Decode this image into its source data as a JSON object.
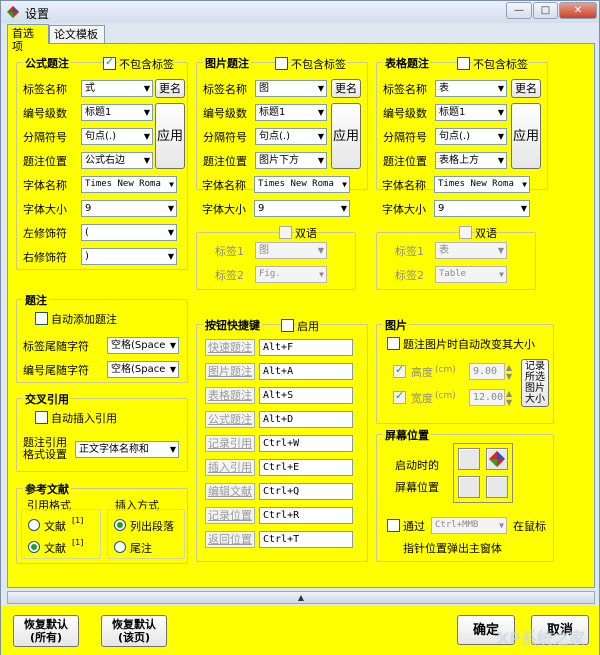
{
  "window": {
    "title": "设置",
    "controls": [
      "—",
      "□",
      "✕"
    ]
  },
  "tabs": [
    "首选项",
    "论文模板"
  ],
  "formula": {
    "title": "公式题注",
    "exclude_label": "不包含标签",
    "labels": [
      "标签名称",
      "编号级数",
      "分隔符号",
      "题注位置",
      "字体名称",
      "字体大小",
      "左修饰符",
      "右修饰符"
    ],
    "values": [
      "式",
      "标题1",
      "句点(.)",
      "公式右边",
      "Times New Roma",
      "9",
      "(",
      ")"
    ],
    "rename": "更名",
    "apply": "应用"
  },
  "figure": {
    "title": "图片题注",
    "exclude_label": "不包含标签",
    "labels": [
      "标签名称",
      "编号级数",
      "分隔符号",
      "题注位置",
      "字体名称",
      "字体大小"
    ],
    "values": [
      "图",
      "标题1",
      "句点(.)",
      "图片下方",
      "Times New Roma",
      "9"
    ],
    "rename": "更名",
    "apply": "应用",
    "bilingual": "双语",
    "tag1": "标签1",
    "tag2": "标签2",
    "tag1_value": "图",
    "tag2_value": "Fig."
  },
  "table": {
    "title": "表格题注",
    "exclude_label": "不包含标签",
    "labels": [
      "标签名称",
      "编号级数",
      "分隔符号",
      "题注位置",
      "字体名称",
      "字体大小"
    ],
    "values": [
      "表",
      "标题1",
      "句点(.)",
      "表格上方",
      "Times New Roma",
      "9"
    ],
    "rename": "更名",
    "apply": "应用",
    "bilingual": "双语",
    "tag1": "标签1",
    "tag2": "标签2",
    "tag1_value": "表",
    "tag2_value": "Table"
  },
  "caption": {
    "title": "题注",
    "auto_add": "自动添加题注",
    "tail_label": "标签尾随字符",
    "tail_value": "空格(Space",
    "num_tail_label": "编号尾随字符",
    "num_tail_value": "空格(Space"
  },
  "crossref": {
    "title": "交叉引用",
    "auto_insert": "自动插入引用",
    "format_label": "题注引用格式设置",
    "format_value": "正文字体名称和"
  },
  "refs": {
    "title": "参考文献",
    "cite_format": "引用格式",
    "insert_mode": "插入方式",
    "opt1": "文献",
    "opt1_sup": "[1]",
    "opt2": "文献",
    "opt2_sup": "[1]",
    "mode1": "列出段落",
    "mode2": "尾注"
  },
  "shortcuts": {
    "title": "按钮快捷键",
    "enable": "启用",
    "items": [
      {
        "name": "快速题注",
        "key": "Alt+F"
      },
      {
        "name": "图片题注",
        "key": "Alt+A"
      },
      {
        "name": "表格题注",
        "key": "Alt+S"
      },
      {
        "name": "公式题注",
        "key": "Alt+D"
      },
      {
        "name": "记录引用",
        "key": "Ctrl+W"
      },
      {
        "name": "插入引用",
        "key": "Ctrl+E"
      },
      {
        "name": "编辑文献",
        "key": "Ctrl+Q"
      },
      {
        "name": "记录位置",
        "key": "Ctrl+R"
      },
      {
        "name": "返回位置",
        "key": "Ctrl+T"
      }
    ]
  },
  "image": {
    "title": "图片",
    "auto_resize": "题注图片时自动改变其大小",
    "height_label": "高度",
    "height_unit": "(cm)",
    "height_value": "9.00",
    "width_label": "宽度",
    "width_unit": "(cm)",
    "width_value": "12.00",
    "record_btn": "记录所选图片大小"
  },
  "screen": {
    "title": "屏幕位置",
    "start_label": "启动时的",
    "pos_label": "屏幕位置",
    "via": "通过",
    "hotkey": "Ctrl+MMB",
    "at_mouse": "在鼠标",
    "popup": "指针位置弹出主窗体"
  },
  "status": {
    "arrow": "▲"
  },
  "buttons": {
    "reset_all": "恢复默认(所有)",
    "reset_page": "恢复默认(该页)",
    "ok": "确定",
    "cancel": "取消"
  },
  "watermark": "XP系统之家"
}
